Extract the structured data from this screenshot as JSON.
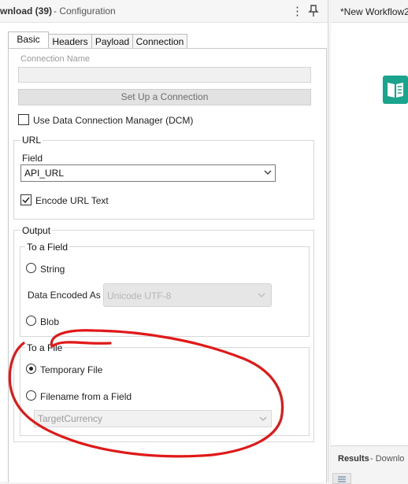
{
  "config": {
    "title_tool": "wnload (39)",
    "title_suffix": " - Configuration",
    "menu_glyph": "⋮",
    "pin_glyph": "📌",
    "tabs": [
      {
        "label": "Basic",
        "active": true
      },
      {
        "label": "Headers",
        "active": false
      },
      {
        "label": "Payload",
        "active": false
      },
      {
        "label": "Connection",
        "active": false
      }
    ],
    "connection_name_label": "Connection Name",
    "connection_name_value": "",
    "setup_button": "Set Up a Connection",
    "dcm_label": "Use Data Connection Manager (DCM)",
    "dcm_checked": false,
    "url": {
      "group_label": "URL",
      "field_label": "Field",
      "field_value": "API_URL",
      "encode_label": "Encode URL Text",
      "encode_checked": true
    },
    "output": {
      "group_label": "Output",
      "to_field": {
        "label": "To a Field",
        "string_label": "String",
        "string_selected": false,
        "encoded_label": "Data Encoded As",
        "encoded_value": "Unicode UTF-8",
        "blob_label": "Blob",
        "blob_selected": false
      },
      "to_file": {
        "label": "To a File",
        "temp_label": "Temporary File",
        "temp_selected": true,
        "filename_label": "Filename from a Field",
        "filename_selected": false,
        "filename_field_value": "TargetCurrency"
      }
    },
    "chevron_glyph": "⌵"
  },
  "workflow": {
    "tab_title": "*New Workflow2",
    "tool_icon": "book-icon",
    "accent_color": "#1aa38d"
  },
  "results": {
    "title": "Results",
    "subtitle": " - Downlo",
    "list_icon": "list-icon"
  },
  "annotation": {
    "color": "#e01818",
    "shape": "hand-drawn ellipse around To a File section"
  }
}
